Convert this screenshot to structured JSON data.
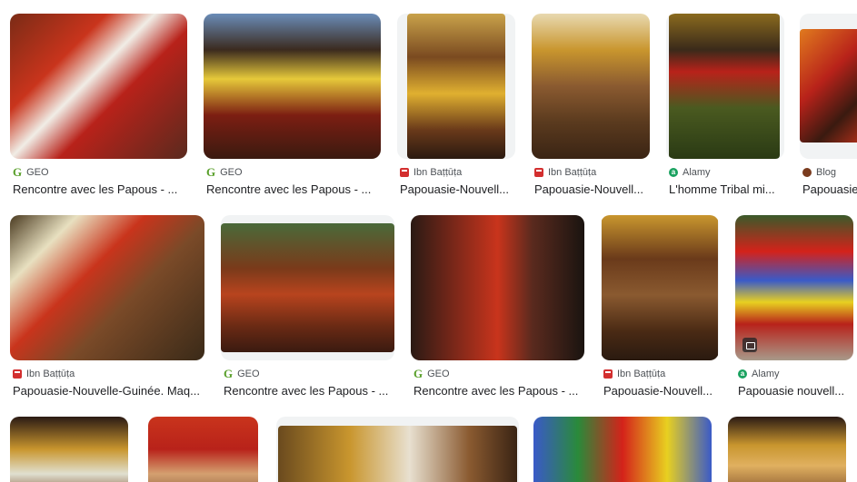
{
  "results": [
    {
      "source": "GEO",
      "favicon": "geo-icon",
      "title": "Rencontre avec les Papous - ..."
    },
    {
      "source": "GEO",
      "favicon": "geo-icon",
      "title": "Rencontre avec les Papous - ..."
    },
    {
      "source": "Ibn Baṭṭūṭa",
      "favicon": "ibn-battuta-icon",
      "title": "Papouasie-Nouvell..."
    },
    {
      "source": "Ibn Baṭṭūṭa",
      "favicon": "ibn-battuta-icon",
      "title": "Papouasie-Nouvell..."
    },
    {
      "source": "Alamy",
      "favicon": "alamy-icon",
      "title": "L'homme Tribal mi..."
    },
    {
      "source": "Blog",
      "favicon": "blog-icon",
      "title": "Papouasie"
    },
    {
      "source": "Ibn Baṭṭūṭa",
      "favicon": "ibn-battuta-icon",
      "title": "Papouasie-Nouvelle-Guinée. Maq..."
    },
    {
      "source": "GEO",
      "favicon": "geo-icon",
      "title": "Rencontre avec les Papous - ..."
    },
    {
      "source": "GEO",
      "favicon": "geo-icon",
      "title": "Rencontre avec les Papous - ..."
    },
    {
      "source": "Ibn Baṭṭūṭa",
      "favicon": "ibn-battuta-icon",
      "title": "Papouasie-Nouvell..."
    },
    {
      "source": "Alamy",
      "favicon": "alamy-icon",
      "title": "Papouasie nouvell..."
    }
  ],
  "favicon_glyphs": {
    "geo": "G",
    "alamy": "a"
  },
  "colors": {
    "geo": "#5aa02c",
    "ibn_battuta": "#d32f2f",
    "alamy": "#1aa260",
    "blog": "#7a3b1e",
    "title_text": "#202124",
    "source_text": "#4d5156"
  }
}
